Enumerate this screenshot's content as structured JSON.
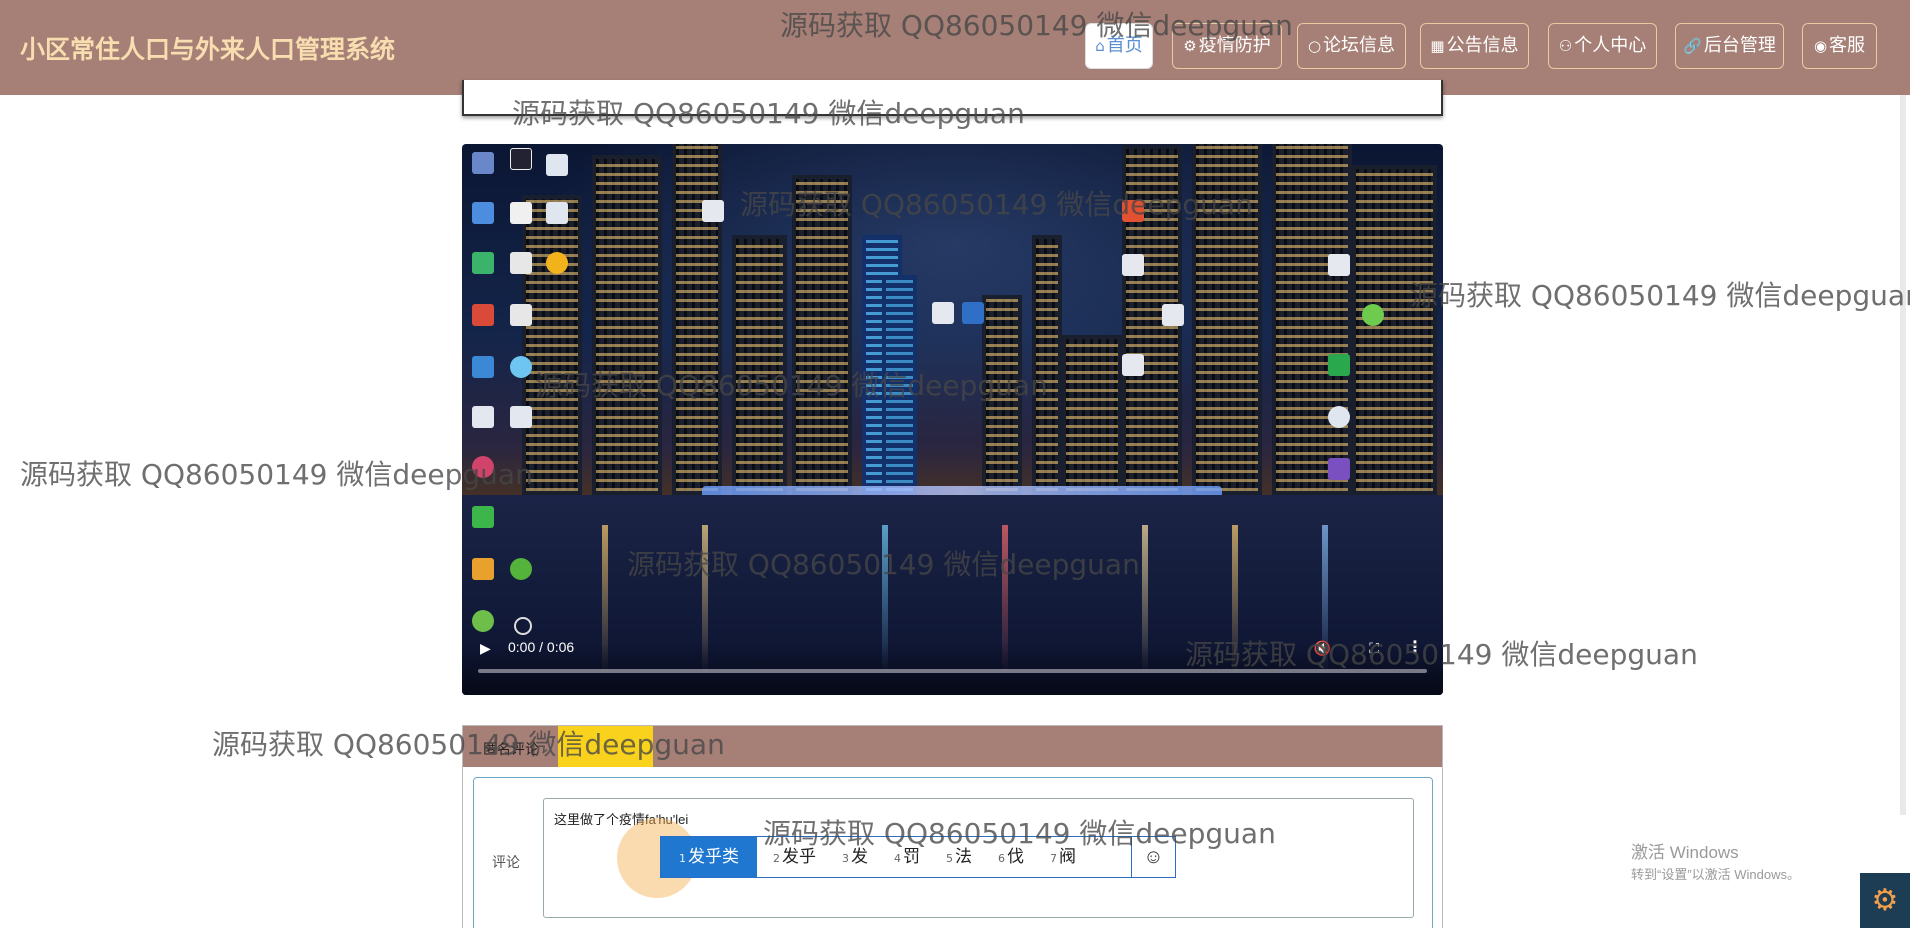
{
  "brand": "小区常住人口与外来人口管理系统",
  "nav": [
    {
      "icon": "⌂",
      "label": "首页",
      "active": true
    },
    {
      "icon": "⚙",
      "label": "疫情防护"
    },
    {
      "icon": "○",
      "label": "论坛信息"
    },
    {
      "icon": "▦",
      "label": "公告信息"
    },
    {
      "icon": "⚇",
      "label": "个人中心"
    },
    {
      "icon": "🔗",
      "label": "后台管理"
    },
    {
      "icon": "◉",
      "label": "客服"
    }
  ],
  "video": {
    "time": "0:00 / 0:06",
    "play_icon": "▶",
    "volume_icon": "🔇",
    "fullscreen_icon": "⛶",
    "more_icon": "⋮"
  },
  "comment": {
    "panel_title": "匿名评论",
    "label": "评论",
    "text": "这里做了个疫情fa'hu'lei",
    "ime_candidates": [
      {
        "n": "1",
        "text": "发乎类",
        "selected": true
      },
      {
        "n": "2",
        "text": "发乎"
      },
      {
        "n": "3",
        "text": "发"
      },
      {
        "n": "4",
        "text": "罚"
      },
      {
        "n": "5",
        "text": "法"
      },
      {
        "n": "6",
        "text": "伐"
      },
      {
        "n": "7",
        "text": "阀"
      }
    ],
    "ime_emoji": "☺"
  },
  "watermark": "源码获取 QQ86050149 微信deepguan",
  "activation": {
    "line1": "激活 Windows",
    "line2": "转到“设置”以激活 Windows。"
  },
  "colors": {
    "header": "#a67f76",
    "brand_text": "#f7ddb0",
    "highlight": "#f9d21d",
    "ime_selected": "#1f77d0"
  }
}
